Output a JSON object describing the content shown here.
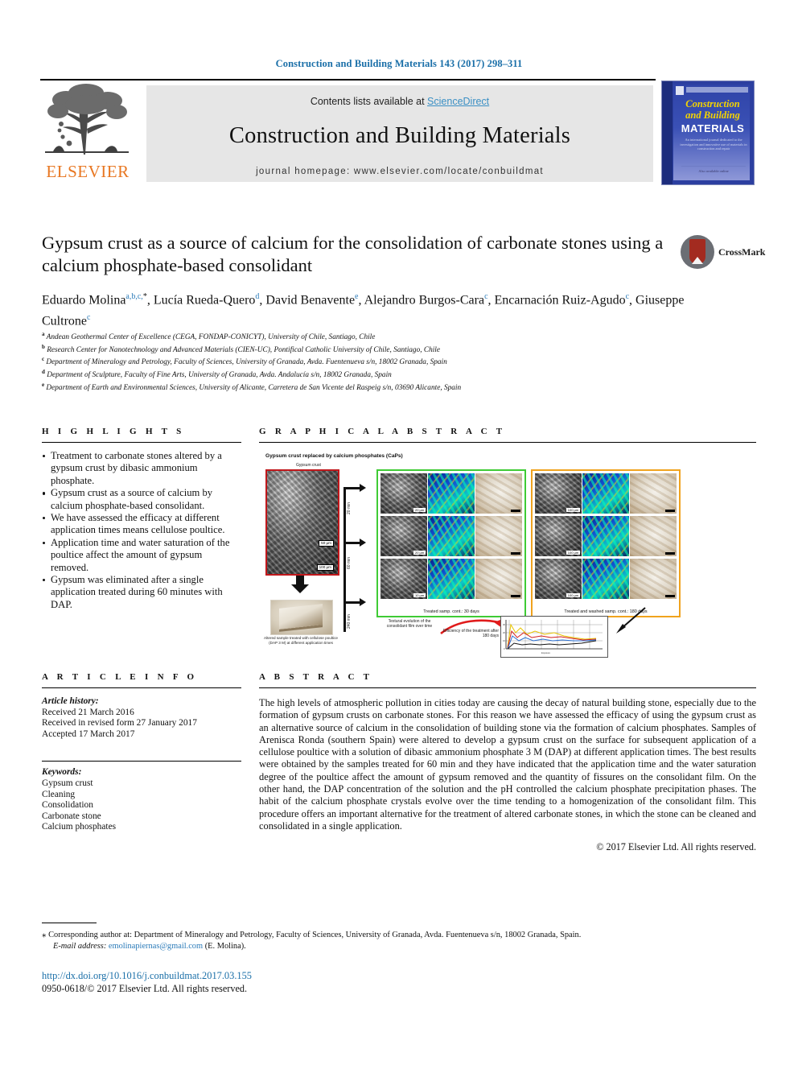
{
  "running_head": "Construction and Building Materials 143 (2017) 298–311",
  "banner": {
    "contents_prefix": "Contents lists available at ",
    "sciencedirect": "ScienceDirect",
    "journal_title": "Construction and Building Materials",
    "homepage": "journal homepage: www.elsevier.com/locate/conbuildmat",
    "publisher": "ELSEVIER",
    "cover": {
      "line1": "Construction",
      "line2": "and Building",
      "line3": "MATERIALS",
      "blurb": "An international journal dedicated to the investigation and innovative use of materials in construction and repair",
      "footer": "Also available online"
    }
  },
  "title": "Gypsum crust as a source of calcium for the consolidation of carbonate stones using a calcium phosphate-based consolidant",
  "crossmark_label": "CrossMark",
  "authors_html": "Eduardo Molina<sup>a,b,c,</sup><sup class=\"ast\">*</sup>, Lucía Rueda-Quero<sup>d</sup>, David Benavente<sup>e</sup>, Alejandro Burgos-Cara<sup>c</sup>, Encarnación Ruiz-Agudo<sup>c</sup>, Giuseppe Cultrone<sup>c</sup>",
  "affiliations": [
    {
      "mark": "a",
      "text": "Andean Geothermal Center of Excellence (CEGA, FONDAP-CONICYT), University of Chile, Santiago, Chile"
    },
    {
      "mark": "b",
      "text": "Research Center for Nanotechnology and Advanced Materials (CIEN-UC), Pontifical Catholic University of Chile, Santiago, Chile"
    },
    {
      "mark": "c",
      "text": "Department of Mineralogy and Petrology, Faculty of Sciences, University of Granada, Avda. Fuentenueva s/n, 18002 Granada, Spain"
    },
    {
      "mark": "d",
      "text": "Department of Sculpture, Faculty of Fine Arts, University of Granada, Avda. Andalucía s/n, 18002 Granada, Spain"
    },
    {
      "mark": "e",
      "text": "Department of Earth and Environmental Sciences, University of Alicante, Carretera de San Vicente del Raspeig s/n, 03690 Alicante, Spain"
    }
  ],
  "highlights": {
    "heading": "H I G H L I G H T S",
    "items": [
      "Treatment to carbonate stones altered by a gypsum crust by dibasic ammonium phosphate.",
      "Gypsum crust as a source of calcium by calcium phosphate-based consolidant.",
      "We have assessed the efficacy at different application times means cellulose poultice.",
      "Application time and water saturation of the poultice affect the amount of gypsum removed.",
      "Gypsum was eliminated after a single application treated during 60 minutes with DAP."
    ]
  },
  "graphical_abstract": {
    "heading": "G R A P H I C A L   A B S T R A C T",
    "figure_title": "Gypsum crust replaced by calcium phosphates (CaPs)",
    "crust_label": "Gypsum crust",
    "crust_scalebar_1": "50 µm",
    "crust_scalebar_2": "100 µm",
    "sample_caption": "Altered sample treated with cellulose poultice (DAP 3 M) at different application times",
    "branch_times": [
      "20 min",
      "60 min",
      "240 min"
    ],
    "panel_green_caption": "Treated samp. cont.: 30 days",
    "panel_orange_caption": "Treated and washed samp. cont.: 180 days",
    "evolution_note": "Textural evolution of the consolidant film over time",
    "efficiency_note": "Efficiency of the treatment after 180 days",
    "tile_scalebars": [
      "20 µm",
      "20 µm",
      "10 µm",
      "100 µm",
      "100 µm",
      "100 µm"
    ]
  },
  "article_info": {
    "heading": "A R T I C L E   I N F O",
    "history_label": "Article history:",
    "history": [
      "Received 21 March 2016",
      "Received in revised form 27 January 2017",
      "Accepted 17 March 2017"
    ],
    "keywords_label": "Keywords:",
    "keywords": [
      "Gypsum crust",
      "Cleaning",
      "Consolidation",
      "Carbonate stone",
      "Calcium phosphates"
    ]
  },
  "abstract": {
    "heading": "A B S T R A C T",
    "text": "The high levels of atmospheric pollution in cities today are causing the decay of natural building stone, especially due to the formation of gypsum crusts on carbonate stones. For this reason we have assessed the efficacy of using the gypsum crust as an alternative source of calcium in the consolidation of building stone via the formation of calcium phosphates. Samples of Arenisca Ronda (southern Spain) were altered to develop a gypsum crust on the surface for subsequent application of a cellulose poultice with a solution of dibasic ammonium phosphate 3 M (DAP) at different application times. The best results were obtained by the samples treated for 60 min and they have indicated that the application time and the water saturation degree of the poultice affect the amount of gypsum removed and the quantity of fissures on the consolidant film. On the other hand, the DAP concentration of the solution and the pH controlled the calcium phosphate precipitation phases. The habit of the calcium phosphate crystals evolve over the time tending to a homogenization of the consolidant film. This procedure offers an important alternative for the treatment of altered carbonate stones, in which the stone can be cleaned and consolidated in a single application.",
    "copyright": "© 2017 Elsevier Ltd. All rights reserved."
  },
  "footer": {
    "corresponding_star": "⁎",
    "corresponding": "Corresponding author at: Department of Mineralogy and Petrology, Faculty of Sciences, University of Granada, Avda. Fuentenueva s/n, 18002 Granada, Spain.",
    "email_label": "E-mail address:",
    "email": "emolinapiernas@gmail.com",
    "email_owner": "(E. Molina).",
    "doi": "http://dx.doi.org/10.1016/j.conbuildmat.2017.03.155",
    "issn": "0950-0618/© 2017 Elsevier Ltd. All rights reserved."
  },
  "colors": {
    "link_blue": "#1a6fa8",
    "sd_blue": "#3a8fc4",
    "elsevier_orange": "#e87722",
    "crossmark_red": "#a32b20",
    "panel_green": "#3fcb35",
    "panel_orange": "#f0a31e",
    "crust_red": "#c0171b"
  }
}
